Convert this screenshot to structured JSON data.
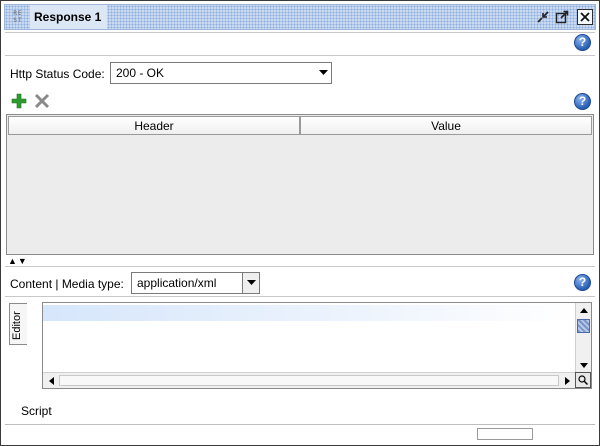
{
  "window": {
    "title": "Response 1",
    "icon": "rest-icon",
    "icon_text": "RE ST"
  },
  "status": {
    "label": "Http Status Code:",
    "value": "200 - OK"
  },
  "headers_table": {
    "columns": [
      "Header",
      "Value"
    ],
    "rows": []
  },
  "content": {
    "label": "Content | Media type:",
    "media_type": "application/xml"
  },
  "editor": {
    "tab_label": "Editor"
  },
  "script_tab": {
    "label": "Script"
  },
  "help_glyph": "?",
  "colors": {
    "titlebar": "#c9d9f0",
    "add_icon": "#2e9b2e",
    "remove_icon": "#8a8a8a",
    "help_icon": "#2a5fb3"
  }
}
